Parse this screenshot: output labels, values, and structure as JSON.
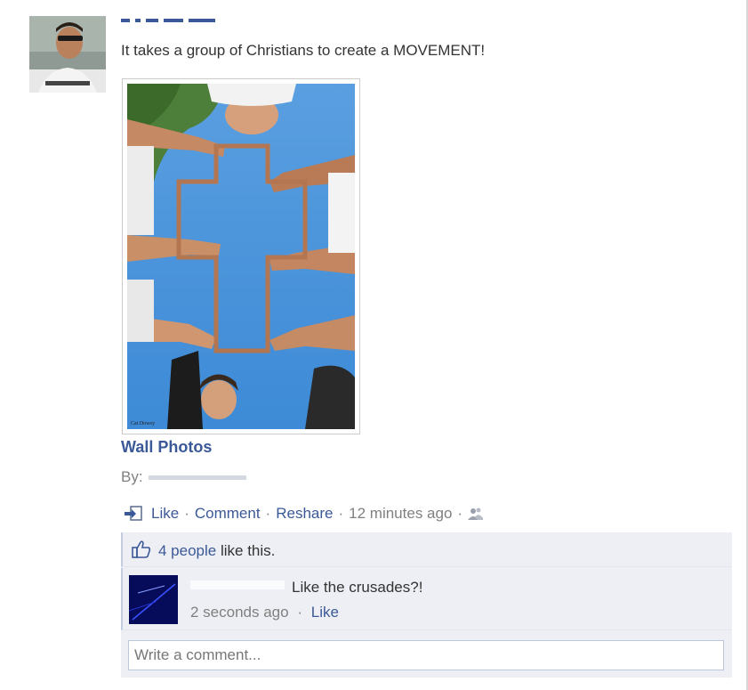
{
  "post": {
    "author_name": "",
    "text": "It takes a group of Christians to create a MOVEMENT!",
    "photo_watermark": "Cat Dowey"
  },
  "album": {
    "title": "Wall Photos",
    "by_label": "By:"
  },
  "actions": {
    "like": "Like",
    "comment": "Comment",
    "reshare": "Reshare",
    "timestamp": "12 minutes ago",
    "separator": "·"
  },
  "likes": {
    "count_link": "4 people",
    "suffix": "like this."
  },
  "comment": {
    "text": "Like the crusades?!",
    "timestamp": "2 seconds ago",
    "like": "Like"
  },
  "composer": {
    "placeholder": "Write a comment..."
  },
  "icons": [
    "share-icon",
    "friends-icon",
    "thumbs-up-icon"
  ],
  "colors": {
    "link": "#3b5998",
    "muted": "#808080",
    "ufi_bg": "#edeff4",
    "sky": "#4a90d9"
  }
}
